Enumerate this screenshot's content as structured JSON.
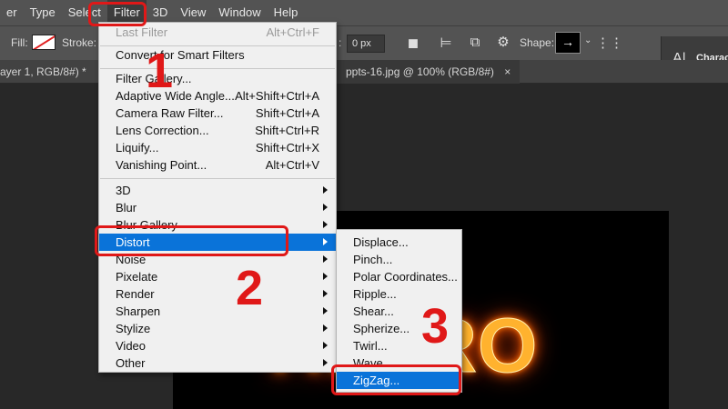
{
  "menubar": {
    "items": [
      "er",
      "Type",
      "Select",
      "Filter",
      "3D",
      "View",
      "Window",
      "Help"
    ],
    "active_index": 3
  },
  "options": {
    "fill_label": "Fill:",
    "stroke_label": "Stroke:",
    "width_colon": ":",
    "width_value": "0 px",
    "shape_label": "Shape:",
    "panel_label": "Characte"
  },
  "tabs": {
    "left": "ayer 1, RGB/8#) *",
    "right": "ppts-16.jpg @ 100% (RGB/8#)",
    "right_close": "×"
  },
  "canvas": {
    "text": "HI PRO"
  },
  "filter_menu": {
    "last_filter": {
      "label": "Last Filter",
      "shortcut": "Alt+Ctrl+F"
    },
    "convert": {
      "label": "Convert for Smart Filters"
    },
    "items_group1": [
      {
        "label": "Filter Gallery...",
        "shortcut": ""
      },
      {
        "label": "Adaptive Wide Angle...",
        "shortcut": "Alt+Shift+Ctrl+A"
      },
      {
        "label": "Camera Raw Filter...",
        "shortcut": "Shift+Ctrl+A"
      },
      {
        "label": "Lens Correction...",
        "shortcut": "Shift+Ctrl+R"
      },
      {
        "label": "Liquify...",
        "shortcut": "Shift+Ctrl+X"
      },
      {
        "label": "Vanishing Point...",
        "shortcut": "Alt+Ctrl+V"
      }
    ],
    "submenus": [
      "3D",
      "Blur",
      "Blur Gallery",
      "Distort",
      "Noise",
      "Pixelate",
      "Render",
      "Sharpen",
      "Stylize",
      "Video",
      "Other"
    ],
    "highlighted": "Distort"
  },
  "distort_menu": {
    "items": [
      "Displace...",
      "Pinch...",
      "Polar Coordinates...",
      "Ripple...",
      "Shear...",
      "Spherize...",
      "Twirl...",
      "Wave...",
      "ZigZag..."
    ],
    "highlighted": "ZigZag..."
  },
  "annotations": {
    "step1": "1",
    "step2": "2",
    "step3": "3"
  },
  "colors": {
    "menu_highlight": "#0a73d9",
    "annotation_red": "#e01818",
    "ui_dark": "#535353",
    "glow_orange": "#ffb22e"
  }
}
